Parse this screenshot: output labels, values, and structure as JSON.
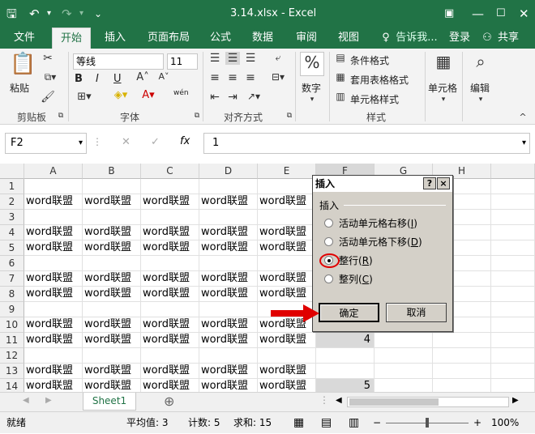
{
  "window": {
    "title": "3.14.xlsx - Excel"
  },
  "tabs": [
    {
      "label": "文件"
    },
    {
      "label": "开始"
    },
    {
      "label": "插入"
    },
    {
      "label": "页面布局"
    },
    {
      "label": "公式"
    },
    {
      "label": "数据"
    },
    {
      "label": "审阅"
    },
    {
      "label": "视图"
    }
  ],
  "tellme": "告诉我...",
  "login": "登录",
  "share": "共享",
  "ribbon": {
    "paste": "粘贴",
    "clipboard": "剪贴板",
    "font_name": "等线",
    "font_size": "11",
    "bold": "B",
    "italic": "I",
    "underline": "U",
    "font_group": "字体",
    "align_group": "对齐方式",
    "number": "数字",
    "cond_format": "条件格式",
    "table_format": "套用表格格式",
    "cell_style": "单元格样式",
    "style_group": "样式",
    "cells": "单元格",
    "editing": "编辑",
    "wen": "wén"
  },
  "formula_bar": {
    "name_box": "F2",
    "fx": "fx",
    "value": "1"
  },
  "columns": [
    "A",
    "B",
    "C",
    "D",
    "E",
    "F",
    "G",
    "H"
  ],
  "rows": [
    {
      "n": "1",
      "text": ""
    },
    {
      "n": "2",
      "text": "word联盟"
    },
    {
      "n": "3",
      "text": ""
    },
    {
      "n": "4",
      "text": "word联盟"
    },
    {
      "n": "5",
      "text": "word联盟"
    },
    {
      "n": "6",
      "text": ""
    },
    {
      "n": "7",
      "text": "word联盟"
    },
    {
      "n": "8",
      "text": "word联盟"
    },
    {
      "n": "9",
      "text": ""
    },
    {
      "n": "10",
      "text": "word联盟"
    },
    {
      "n": "11",
      "text": "word联盟"
    },
    {
      "n": "12",
      "text": ""
    },
    {
      "n": "13",
      "text": "word联盟"
    },
    {
      "n": "14",
      "text": "word联盟"
    }
  ],
  "f_values": {
    "r11": "4",
    "r14": "5"
  },
  "sheet": {
    "name": "Sheet1",
    "add": "⊕"
  },
  "status": {
    "ready": "就绪",
    "avg": "平均值: 3",
    "count": "计数: 5",
    "sum": "求和: 15",
    "zoom": "100%"
  },
  "dialog": {
    "title": "插入",
    "help": "?",
    "close": "×",
    "group": "插入",
    "options": [
      {
        "label": "活动单元格右移(",
        "key": "I",
        "end": ")"
      },
      {
        "label": "活动单元格下移(",
        "key": "D",
        "end": ")"
      },
      {
        "label": "整行(",
        "key": "R",
        "end": ")"
      },
      {
        "label": "整列(",
        "key": "C",
        "end": ")"
      }
    ],
    "selected": 2,
    "ok": "确定",
    "cancel": "取消"
  },
  "colors": {
    "excel_green": "#217346",
    "arrow_red": "#e00000"
  }
}
